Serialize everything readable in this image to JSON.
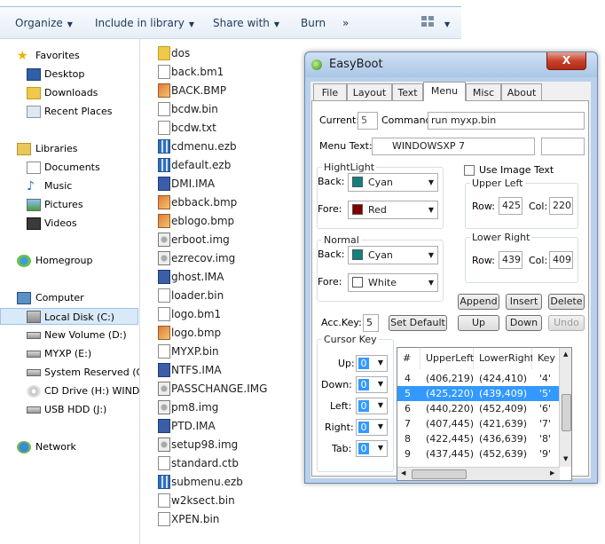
{
  "toolbar": {
    "organize": "Organize",
    "include_in_library": "Include in library",
    "share_with": "Share with",
    "burn": "Burn",
    "more": "»"
  },
  "nav": {
    "favorites": "Favorites",
    "desktop": "Desktop",
    "downloads": "Downloads",
    "recent_places": "Recent Places",
    "libraries": "Libraries",
    "documents": "Documents",
    "music": "Music",
    "pictures": "Pictures",
    "videos": "Videos",
    "homegroup": "Homegroup",
    "computer": "Computer",
    "local_disk": "Local Disk (C:)",
    "new_volume_d": "New Volume (D:)",
    "new_volume_e": "MYXP (E:)",
    "system_reserved": "System Reserved (G:",
    "cd_drive": "CD Drive (H:) WINDO",
    "usb_hdd": "USB HDD (J:)",
    "network": "Network"
  },
  "files": [
    {
      "name": "dos",
      "icon": "folder-icon"
    },
    {
      "name": "back.bm1",
      "icon": "document-icon"
    },
    {
      "name": "BACK.BMP",
      "icon": "bitmap-icon"
    },
    {
      "name": "bcdw.bin",
      "icon": "document-icon"
    },
    {
      "name": "bcdw.txt",
      "icon": "document-icon"
    },
    {
      "name": "cdmenu.ezb",
      "icon": "ezb-icon"
    },
    {
      "name": "default.ezb",
      "icon": "ezb-icon"
    },
    {
      "name": "DMI.IMA",
      "icon": "floppy-icon"
    },
    {
      "name": "ebback.bmp",
      "icon": "bitmap-icon"
    },
    {
      "name": "eblogo.bmp",
      "icon": "bitmap-icon"
    },
    {
      "name": "erboot.img",
      "icon": "disc-image-icon"
    },
    {
      "name": "ezrecov.img",
      "icon": "disc-image-icon"
    },
    {
      "name": "ghost.IMA",
      "icon": "floppy-icon"
    },
    {
      "name": "loader.bin",
      "icon": "document-icon"
    },
    {
      "name": "logo.bm1",
      "icon": "document-icon"
    },
    {
      "name": "logo.bmp",
      "icon": "bitmap-icon"
    },
    {
      "name": "MYXP.bin",
      "icon": "document-icon"
    },
    {
      "name": "NTFS.IMA",
      "icon": "floppy-icon"
    },
    {
      "name": "PASSCHANGE.IMG",
      "icon": "disc-image-icon"
    },
    {
      "name": "pm8.img",
      "icon": "disc-image-icon"
    },
    {
      "name": "PTD.IMA",
      "icon": "floppy-icon"
    },
    {
      "name": "setup98.img",
      "icon": "disc-image-icon"
    },
    {
      "name": "standard.ctb",
      "icon": "document-icon"
    },
    {
      "name": "submenu.ezb",
      "icon": "ezb-icon"
    },
    {
      "name": "w2ksect.bin",
      "icon": "document-icon"
    },
    {
      "name": "XPEN.bin",
      "icon": "document-icon"
    }
  ],
  "dialog": {
    "title": "EasyBoot",
    "close": "X",
    "tabs": [
      "File",
      "Layout",
      "Text",
      "Menu",
      "Misc",
      "About"
    ],
    "current_label": "Current:",
    "current_value": "5",
    "command_label": "Command:",
    "command_value": "run myxp.bin",
    "menu_text_label": "Menu Text:",
    "menu_text_value": "WINDOWSXP 7",
    "highlight_group": "HightLight",
    "back_label": "Back:",
    "fore_label": "Fore:",
    "hl_back_value": "Cyan",
    "hl_fore_value": "Red",
    "normal_group": "Normal",
    "nm_back_value": "Cyan",
    "nm_fore_value": "White",
    "use_image_text": "Use Image Text",
    "upper_left_group": "Upper Left",
    "lower_right_group": "Lower Right",
    "row_label": "Row:",
    "col_label": "Col:",
    "ul_row": "425",
    "ul_col": "220",
    "lr_row": "439",
    "lr_col": "409",
    "append": "Append",
    "insert": "Insert",
    "delete": "Delete",
    "acc_key_label": "Acc.Key:",
    "acc_key_value": "5",
    "set_default": "Set Default",
    "up": "Up",
    "down": "Down",
    "undo": "Undo",
    "cursor_key_group": "Cursor Key",
    "ck_up": "Up:",
    "ck_down": "Down:",
    "ck_left": "Left:",
    "ck_right": "Right:",
    "ck_tab": "Tab:",
    "ck_value": "0",
    "list_headers": [
      "#",
      "UpperLeft",
      "LowerRight",
      "Key"
    ],
    "list_rows": [
      {
        "n": "4",
        "ul": "(406,219)",
        "lr": "(424,410)",
        "key": "'4'"
      },
      {
        "n": "5",
        "ul": "(425,220)",
        "lr": "(439,409)",
        "key": "'5'"
      },
      {
        "n": "6",
        "ul": "(440,220)",
        "lr": "(452,409)",
        "key": "'6'"
      },
      {
        "n": "7",
        "ul": "(407,445)",
        "lr": "(421,639)",
        "key": "'7'"
      },
      {
        "n": "8",
        "ul": "(422,445)",
        "lr": "(436,639)",
        "key": "'8'"
      },
      {
        "n": "9",
        "ul": "(437,445)",
        "lr": "(452,639)",
        "key": "'9'"
      }
    ]
  },
  "colors": {
    "cyan_swatch": "#138080",
    "red_swatch": "#800000",
    "white_swatch": "#ffffff",
    "selection": "#3399ff"
  }
}
